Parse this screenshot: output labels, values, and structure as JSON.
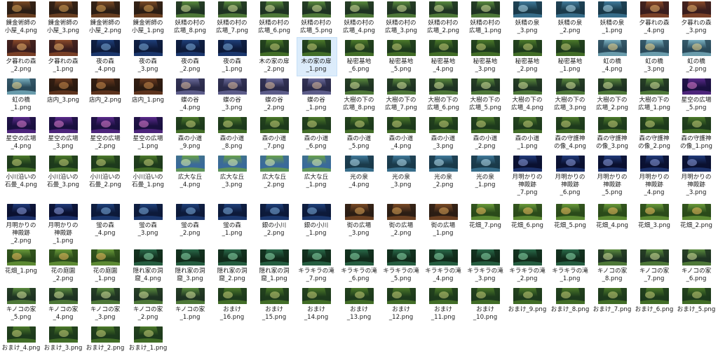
{
  "selected_index": 24,
  "thumb_palettes": {
    "forest": [
      "#1d3a1c",
      "#4c7a2a",
      "#c9d27a"
    ],
    "alchemy": [
      "#2b1d14",
      "#7a4a26",
      "#e0a85a"
    ],
    "night": [
      "#0d1a3a",
      "#1f3f7a",
      "#7fb0e0"
    ],
    "fairy": [
      "#1e3322",
      "#5a8a3e",
      "#d9e8a0"
    ],
    "dusk": [
      "#3a1d1d",
      "#8a4a2a",
      "#f0b870"
    ],
    "spring": [
      "#1a3a4a",
      "#3f7a9a",
      "#b8e0f0"
    ],
    "rainbow": [
      "#2a4a5a",
      "#7ab0c0",
      "#f0d890"
    ],
    "shop": [
      "#2a1a10",
      "#6a3a20",
      "#d09050"
    ],
    "valley": [
      "#2a2a4a",
      "#6a6a9a",
      "#e0c0a0"
    ],
    "starry": [
      "#1a1040",
      "#5a2a8a",
      "#e080d0"
    ],
    "meadow": [
      "#3a6a9a",
      "#6aa04a",
      "#e0f0b0"
    ],
    "cave": [
      "#102a1a",
      "#2a6a4a",
      "#90e0b0"
    ],
    "moon": [
      "#0a1030",
      "#203a7a",
      "#90a0e0"
    ],
    "flower": [
      "#2a4a1a",
      "#6a9a3a",
      "#f0c060"
    ]
  },
  "files": [
    {
      "name": "錬金術師の\n小屋_4.png",
      "p": "alchemy"
    },
    {
      "name": "錬金術師の\n小屋_3.png",
      "p": "alchemy"
    },
    {
      "name": "錬金術師の\n小屋_2.png",
      "p": "alchemy"
    },
    {
      "name": "錬金術師の\n小屋_1.png",
      "p": "alchemy"
    },
    {
      "name": "妖精の村の\n広場_8.png",
      "p": "fairy"
    },
    {
      "name": "妖精の村の\n広場_7.png",
      "p": "fairy"
    },
    {
      "name": "妖精の村の\n広場_6.png",
      "p": "fairy"
    },
    {
      "name": "妖精の村の\n広場_5.png",
      "p": "fairy"
    },
    {
      "name": "妖精の村の\n広場_4.png",
      "p": "fairy"
    },
    {
      "name": "妖精の村の\n広場_3.png",
      "p": "fairy"
    },
    {
      "name": "妖精の村の\n広場_2.png",
      "p": "fairy"
    },
    {
      "name": "妖精の村の\n広場_1.png",
      "p": "fairy"
    },
    {
      "name": "妖精の泉\n_3.png",
      "p": "spring"
    },
    {
      "name": "妖精の泉\n_2.png",
      "p": "spring"
    },
    {
      "name": "妖精の泉\n_1.png",
      "p": "spring"
    },
    {
      "name": "夕暮れの森\n_4.png",
      "p": "dusk"
    },
    {
      "name": "夕暮れの森\n_3.png",
      "p": "dusk"
    },
    {
      "name": "夕暮れの森\n_2.png",
      "p": "dusk"
    },
    {
      "name": "夕暮れの森\n_1.png",
      "p": "dusk"
    },
    {
      "name": "夜の森\n_4.png",
      "p": "night"
    },
    {
      "name": "夜の森\n_3.png",
      "p": "night"
    },
    {
      "name": "夜の森\n_2.png",
      "p": "night"
    },
    {
      "name": "夜の森\n_1.png",
      "p": "night"
    },
    {
      "name": "木の家の扉\n_2.png",
      "p": "forest"
    },
    {
      "name": "木の家の扉\n_1.png",
      "p": "forest"
    },
    {
      "name": "秘密基地\n_6.png",
      "p": "forest"
    },
    {
      "name": "秘密基地\n_5.png",
      "p": "forest"
    },
    {
      "name": "秘密基地\n_4.png",
      "p": "forest"
    },
    {
      "name": "秘密基地\n_3.png",
      "p": "forest"
    },
    {
      "name": "秘密基地\n_2.png",
      "p": "forest"
    },
    {
      "name": "秘密基地\n_1.png",
      "p": "forest"
    },
    {
      "name": "虹の橋\n_4.png",
      "p": "rainbow"
    },
    {
      "name": "虹の橋\n_3.png",
      "p": "rainbow"
    },
    {
      "name": "虹の橋\n_2.png",
      "p": "rainbow"
    },
    {
      "name": "虹の橋\n_1.png",
      "p": "rainbow"
    },
    {
      "name": "店内_3.png",
      "p": "shop"
    },
    {
      "name": "店内_2.png",
      "p": "shop"
    },
    {
      "name": "店内_1.png",
      "p": "shop"
    },
    {
      "name": "蝶の谷\n_4.png",
      "p": "valley"
    },
    {
      "name": "蝶の谷\n_3.png",
      "p": "valley"
    },
    {
      "name": "蝶の谷\n_2.png",
      "p": "valley"
    },
    {
      "name": "蝶の谷\n_1.png",
      "p": "valley"
    },
    {
      "name": "大樹の下の\n広場_8.png",
      "p": "fairy"
    },
    {
      "name": "大樹の下の\n広場_7.png",
      "p": "fairy"
    },
    {
      "name": "大樹の下の\n広場_6.png",
      "p": "fairy"
    },
    {
      "name": "大樹の下の\n広場_5.png",
      "p": "fairy"
    },
    {
      "name": "大樹の下の\n広場_4.png",
      "p": "fairy"
    },
    {
      "name": "大樹の下の\n広場_3.png",
      "p": "fairy"
    },
    {
      "name": "大樹の下の\n広場_2.png",
      "p": "fairy"
    },
    {
      "name": "大樹の下の\n広場_1.png",
      "p": "fairy"
    },
    {
      "name": "星空の広場\n_5.png",
      "p": "starry"
    },
    {
      "name": "星空の広場\n_4.png",
      "p": "starry"
    },
    {
      "name": "星空の広場\n_3.png",
      "p": "starry"
    },
    {
      "name": "星空の広場\n_2.png",
      "p": "starry"
    },
    {
      "name": "星空の広場\n_1.png",
      "p": "starry"
    },
    {
      "name": "森の小道\n_9.png",
      "p": "forest"
    },
    {
      "name": "森の小道\n_8.png",
      "p": "forest"
    },
    {
      "name": "森の小道\n_7.png",
      "p": "forest"
    },
    {
      "name": "森の小道\n_6.png",
      "p": "forest"
    },
    {
      "name": "森の小道\n_5.png",
      "p": "forest"
    },
    {
      "name": "森の小道\n_4.png",
      "p": "forest"
    },
    {
      "name": "森の小道\n_3.png",
      "p": "forest"
    },
    {
      "name": "森の小道\n_2.png",
      "p": "forest"
    },
    {
      "name": "森の小道\n_1.png",
      "p": "forest"
    },
    {
      "name": "森の守護神\nの像_4.png",
      "p": "forest"
    },
    {
      "name": "森の守護神\nの像_3.png",
      "p": "forest"
    },
    {
      "name": "森の守護神\nの像_2.png",
      "p": "forest"
    },
    {
      "name": "森の守護神\nの像_1.png",
      "p": "forest"
    },
    {
      "name": "小川沿いの\n石畳_4.png",
      "p": "forest"
    },
    {
      "name": "小川沿いの\n石畳_3.png",
      "p": "forest"
    },
    {
      "name": "小川沿いの\n石畳_2.png",
      "p": "forest"
    },
    {
      "name": "小川沿いの\n石畳_1.png",
      "p": "forest"
    },
    {
      "name": "広大な丘\n_4.png",
      "p": "meadow"
    },
    {
      "name": "広大な丘\n_3.png",
      "p": "meadow"
    },
    {
      "name": "広大な丘\n_2.png",
      "p": "meadow"
    },
    {
      "name": "広大な丘\n_1.png",
      "p": "meadow"
    },
    {
      "name": "光の泉\n_4.png",
      "p": "spring"
    },
    {
      "name": "光の泉\n_3.png",
      "p": "spring"
    },
    {
      "name": "光の泉\n_2.png",
      "p": "spring"
    },
    {
      "name": "光の泉\n_1.png",
      "p": "spring"
    },
    {
      "name": "月明かりの\n神殿跡\n_7.png",
      "p": "moon"
    },
    {
      "name": "月明かりの\n神殿跡\n_6.png",
      "p": "moon"
    },
    {
      "name": "月明かりの\n神殿跡\n_5.png",
      "p": "moon"
    },
    {
      "name": "月明かりの\n神殿跡\n_4.png",
      "p": "moon"
    },
    {
      "name": "月明かりの\n神殿跡\n_3.png",
      "p": "moon"
    },
    {
      "name": "月明かりの\n神殿跡\n_2.png",
      "p": "moon"
    },
    {
      "name": "月明かりの\n神殿跡\n_1.png",
      "p": "moon"
    },
    {
      "name": "蛍の森\n_4.png",
      "p": "night"
    },
    {
      "name": "蛍の森\n_3.png",
      "p": "night"
    },
    {
      "name": "蛍の森\n_2.png",
      "p": "night"
    },
    {
      "name": "蛍の森\n_1.png",
      "p": "night"
    },
    {
      "name": "銀の小川\n_2.png",
      "p": "night"
    },
    {
      "name": "銀の小川\n_1.png",
      "p": "night"
    },
    {
      "name": "街の広場\n_3.png",
      "p": "alchemy"
    },
    {
      "name": "街の広場\n_2.png",
      "p": "alchemy"
    },
    {
      "name": "街の広場\n_1.png",
      "p": "alchemy"
    },
    {
      "name": "花畑_7.png",
      "p": "flower"
    },
    {
      "name": "花畑_6.png",
      "p": "flower"
    },
    {
      "name": "花畑_5.png",
      "p": "flower"
    },
    {
      "name": "花畑_4.png",
      "p": "flower"
    },
    {
      "name": "花畑_3.png",
      "p": "flower"
    },
    {
      "name": "花畑_2.png",
      "p": "flower"
    },
    {
      "name": "花畑_1.png",
      "p": "flower"
    },
    {
      "name": "花の庭園\n_2.png",
      "p": "flower"
    },
    {
      "name": "花の庭園\n_1.png",
      "p": "flower"
    },
    {
      "name": "隠れ家の洞\n窟_4.png",
      "p": "cave"
    },
    {
      "name": "隠れ家の洞\n窟_3.png",
      "p": "cave"
    },
    {
      "name": "隠れ家の洞\n窟_2.png",
      "p": "cave"
    },
    {
      "name": "隠れ家の洞\n窟_1.png",
      "p": "cave"
    },
    {
      "name": "キラキラの滝\n_7.png",
      "p": "cave"
    },
    {
      "name": "キラキラの滝\n_6.png",
      "p": "cave"
    },
    {
      "name": "キラキラの滝\n_5.png",
      "p": "cave"
    },
    {
      "name": "キラキラの滝\n_4.png",
      "p": "cave"
    },
    {
      "name": "キラキラの滝\n_3.png",
      "p": "cave"
    },
    {
      "name": "キラキラの滝\n_2.png",
      "p": "cave"
    },
    {
      "name": "キラキラの滝\n_1.png",
      "p": "cave"
    },
    {
      "name": "キノコの家\n_8.png",
      "p": "fairy"
    },
    {
      "name": "キノコの家\n_7.png",
      "p": "fairy"
    },
    {
      "name": "キノコの家\n_6.png",
      "p": "fairy"
    },
    {
      "name": "キノコの家\n_5.png",
      "p": "fairy"
    },
    {
      "name": "キノコの家\n_4.png",
      "p": "fairy"
    },
    {
      "name": "キノコの家\n_3.png",
      "p": "fairy"
    },
    {
      "name": "キノコの家\n_2.png",
      "p": "fairy"
    },
    {
      "name": "キノコの家\n_1.png",
      "p": "fairy"
    },
    {
      "name": "おまけ\n_16.png",
      "p": "forest"
    },
    {
      "name": "おまけ\n_15.png",
      "p": "forest"
    },
    {
      "name": "おまけ\n_14.png",
      "p": "forest"
    },
    {
      "name": "おまけ\n_13.png",
      "p": "forest"
    },
    {
      "name": "おまけ\n_12.png",
      "p": "forest"
    },
    {
      "name": "おまけ\n_11.png",
      "p": "forest"
    },
    {
      "name": "おまけ\n_10.png",
      "p": "forest"
    },
    {
      "name": "おまけ_9.png",
      "p": "forest"
    },
    {
      "name": "おまけ_8.png",
      "p": "forest"
    },
    {
      "name": "おまけ_7.png",
      "p": "forest"
    },
    {
      "name": "おまけ_6.png",
      "p": "forest"
    },
    {
      "name": "おまけ_5.png",
      "p": "forest"
    },
    {
      "name": "おまけ_4.png",
      "p": "forest"
    },
    {
      "name": "おまけ_3.png",
      "p": "forest"
    },
    {
      "name": "おまけ_2.png",
      "p": "forest"
    },
    {
      "name": "おまけ_1.png",
      "p": "forest"
    }
  ]
}
